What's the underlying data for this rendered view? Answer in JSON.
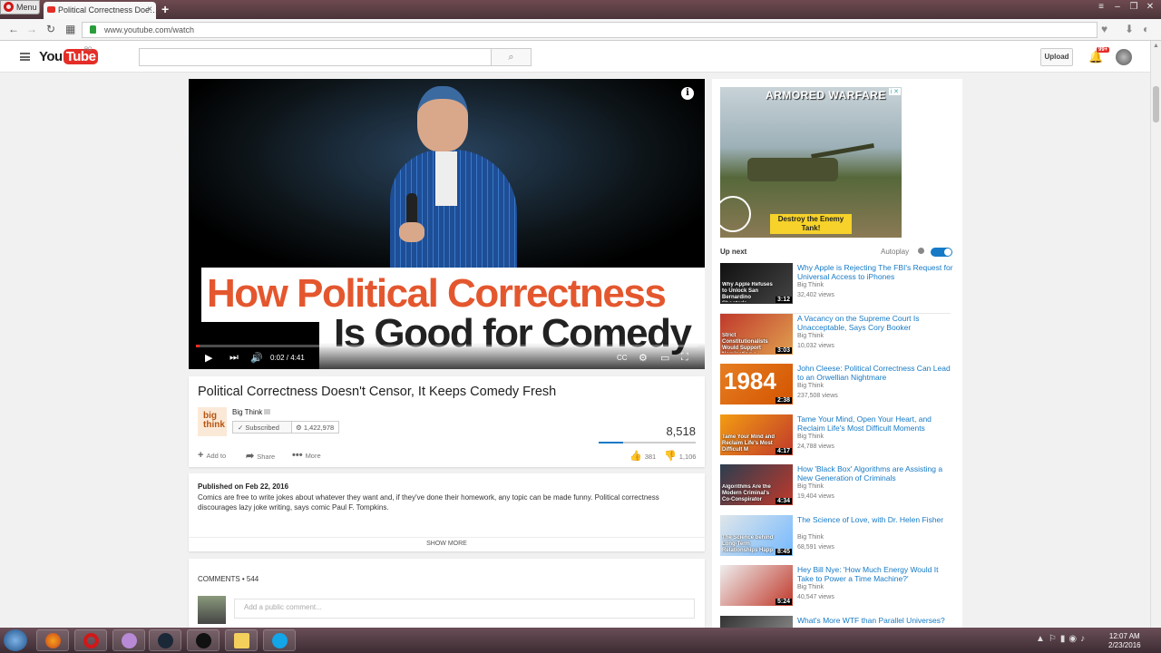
{
  "browser": {
    "menu_label": "Menu",
    "tab_title": "Political Correctness Doe…",
    "url": "www.youtube.com/watch"
  },
  "header": {
    "logo_text": "You",
    "logo_tube": "Tube",
    "logo_region": "RO",
    "upload_label": "Upload",
    "notif_count": "99+"
  },
  "player": {
    "banner_line1": "How Political Correctness",
    "banner_line2": "Is Good for Comedy",
    "time": "0:02 / 4:41",
    "progress_fraction": 0.007
  },
  "video": {
    "title": "Political Correctness Doesn't Censor, It Keeps Comedy Fresh",
    "channel": "Big Think",
    "channel_logo": "big think",
    "subscribe_label": "Subscribed",
    "subscriber_count": "1,422,978",
    "views": "8,518",
    "like_fraction": 0.25,
    "add_to": "Add to",
    "share": "Share",
    "more": "More",
    "likes": "381",
    "dislikes": "1,106"
  },
  "description": {
    "published": "Published on Feb 22, 2016",
    "text": "Comics are free to write jokes about whatever they want and, if they've done their homework, any topic can be made funny. Political correctness discourages lazy joke writing, says comic Paul F. Tompkins.",
    "show_more": "SHOW MORE"
  },
  "comments": {
    "header": "COMMENTS • 544",
    "placeholder": "Add a public comment..."
  },
  "ad": {
    "title": "ARMORED WARFARE",
    "cta": "Destroy the Enemy Tank!"
  },
  "sidebar": {
    "up_next": "Up next",
    "autoplay": "Autoplay",
    "videos": [
      {
        "title": "Why Apple is Rejecting The FBI's Request for Universal Access to iPhones",
        "channel": "Big Think",
        "views": "32,402 views",
        "duration": "3:12",
        "thumb_text": "Why Apple Refuses to Unlock San Bernardino Shooter's"
      },
      {
        "title": "A Vacancy on the Supreme Court Is Unacceptable, Says Cory Booker",
        "channel": "Big Think",
        "views": "10,032 views",
        "duration": "3:03",
        "thumb_text": "Strict Constitutionalists Would Support Nominating a Successor"
      },
      {
        "title": "John Cleese: Political Correctness Can Lead to an Orwellian Nightmare",
        "channel": "Big Think",
        "views": "237,508 views",
        "duration": "2:38",
        "thumb_text": "1984"
      },
      {
        "title": "Tame Your Mind, Open Your Heart, and Reclaim Life's Most Difficult Moments",
        "channel": "Big Think",
        "views": "24,788 views",
        "duration": "4:17",
        "thumb_text": "Tame Your Mind and Reclaim Life's Most Difficult M"
      },
      {
        "title": "How 'Black Box' Algorithms are Assisting a New Generation of Criminals",
        "channel": "Big Think",
        "views": "19,404 views",
        "duration": "4:34",
        "thumb_text": "Algorithms Are the Modern Criminal's Co-Conspirator"
      },
      {
        "title": "The Science of Love, with Dr. Helen Fisher",
        "channel": "Big Think",
        "views": "68,591 views",
        "duration": "8:45",
        "thumb_text": "The Science behind Long-Term Relationships Happ"
      },
      {
        "title": "Hey Bill Nye: 'How Much Energy Would It Take to Power a Time Machine?'",
        "channel": "Big Think",
        "views": "40,547 views",
        "duration": "5:24",
        "thumb_text": ""
      },
      {
        "title": "What's More WTF than Parallel Universes?",
        "channel": "",
        "views": "",
        "duration": "",
        "thumb_text": ""
      }
    ]
  },
  "taskbar": {
    "time": "12:07 AM",
    "date": "2/23/2016"
  },
  "colors": {
    "youtube_red": "#e52d27",
    "link_blue": "#167ac6",
    "banner_orange": "#e4572e"
  }
}
